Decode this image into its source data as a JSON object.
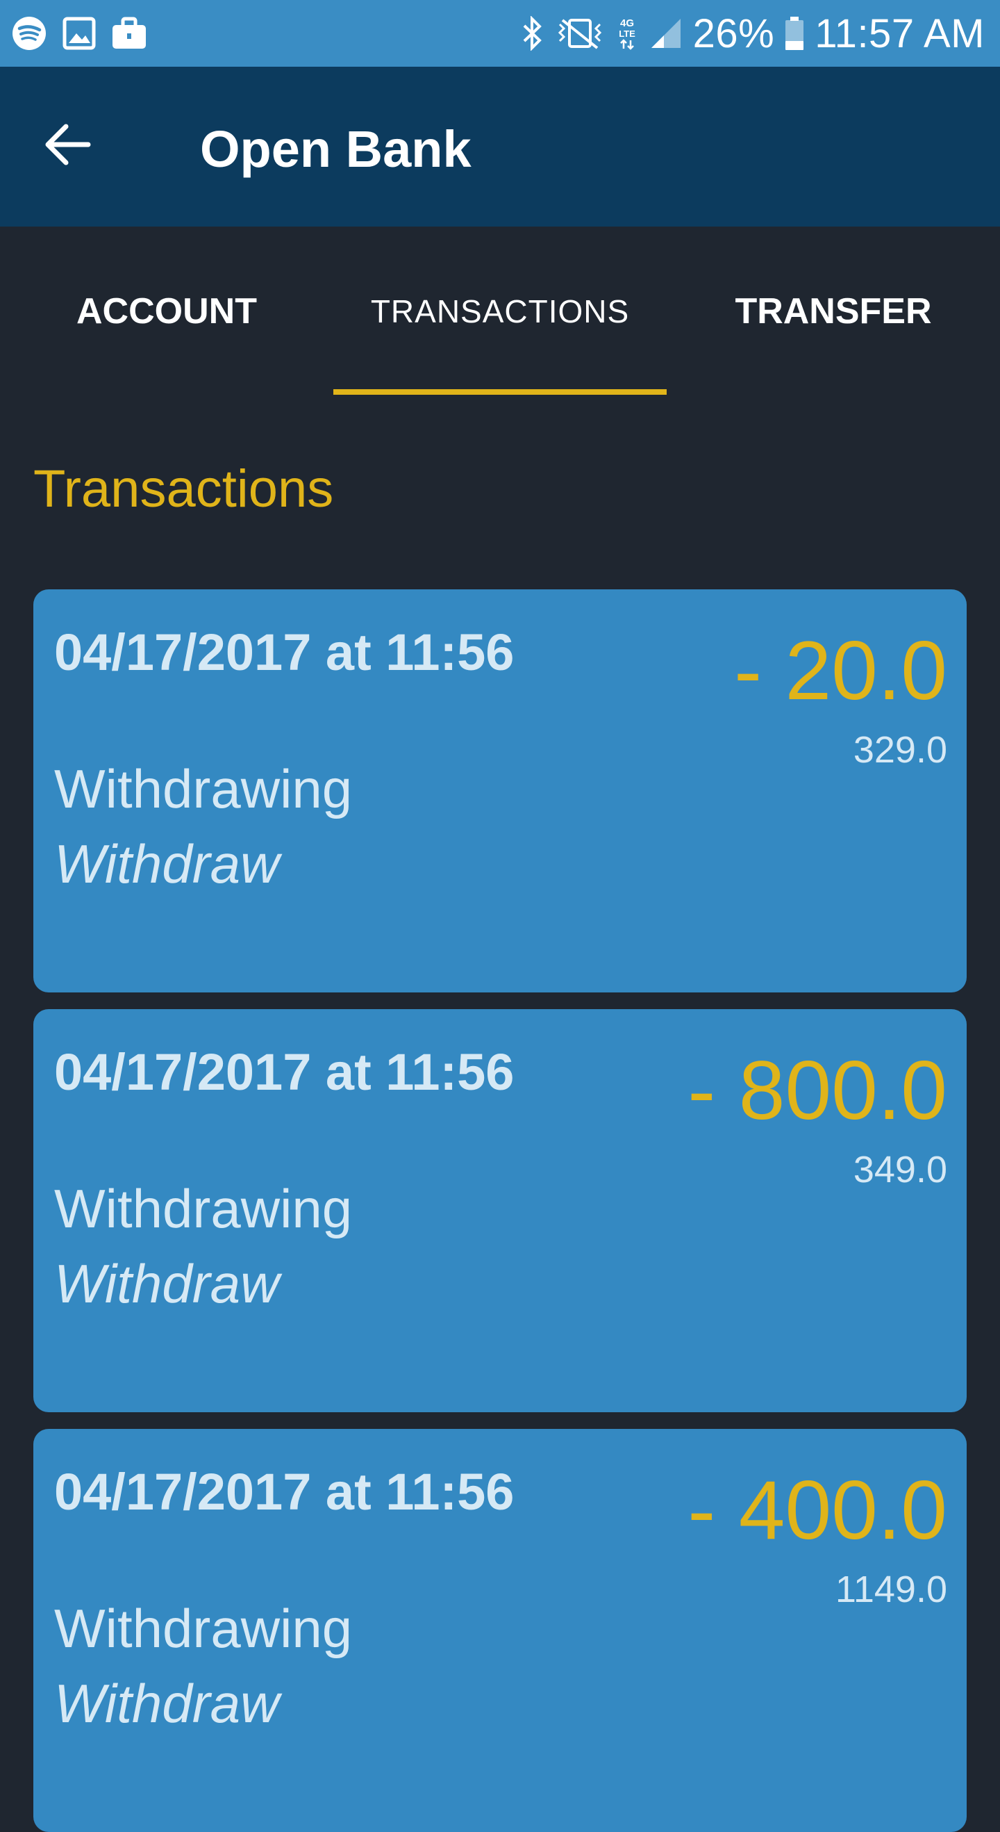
{
  "status_bar": {
    "battery": "26%",
    "time": "11:57 AM",
    "icons": [
      "spotify-icon",
      "gallery-icon",
      "briefcase-icon",
      "bluetooth-icon",
      "vibrate-icon",
      "lte-icon",
      "signal-icon",
      "battery-icon"
    ]
  },
  "app_bar": {
    "title": "Open Bank",
    "back_icon": "arrow-left-icon"
  },
  "tabs": [
    {
      "label": "ACCOUNT",
      "active": false
    },
    {
      "label": "TRANSACTIONS",
      "active": true
    },
    {
      "label": "TRANSFER",
      "active": false
    }
  ],
  "section_title": "Transactions",
  "transactions": [
    {
      "date": "04/17/2017 at 11:56",
      "description": "Withdrawing",
      "type": "Withdraw",
      "amount": "- 20.0",
      "balance": "329.0"
    },
    {
      "date": "04/17/2017 at 11:56",
      "description": "Withdrawing",
      "type": "Withdraw",
      "amount": "- 800.0",
      "balance": "349.0"
    },
    {
      "date": "04/17/2017 at 11:56",
      "description": "Withdrawing",
      "type": "Withdraw",
      "amount": "- 400.0",
      "balance": "1149.0"
    }
  ],
  "colors": {
    "status_bar": "#3a8dc4",
    "app_bar": "#0c3b5e",
    "background": "#1f2630",
    "accent": "#e0b41a",
    "card": "#3489c2",
    "card_text": "#d6e9f5"
  }
}
